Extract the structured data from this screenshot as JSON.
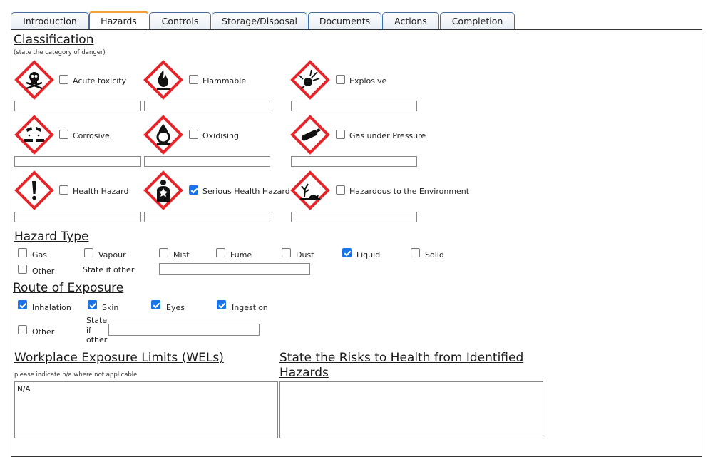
{
  "tabs": [
    "Introduction",
    "Hazards",
    "Controls",
    "Storage/Disposal",
    "Documents",
    "Actions",
    "Completion"
  ],
  "active_tab": "Hazards",
  "classification": {
    "title": "Classification",
    "note": "(state the category of danger)",
    "items": [
      {
        "label": "Acute toxicity",
        "checked": false,
        "icon": "skull-crossbones-icon"
      },
      {
        "label": "Flammable",
        "checked": false,
        "icon": "flame-icon"
      },
      {
        "label": "Explosive",
        "checked": false,
        "icon": "exploding-bomb-icon"
      },
      {
        "label": "Corrosive",
        "checked": false,
        "icon": "corrosion-icon"
      },
      {
        "label": "Oxidising",
        "checked": false,
        "icon": "flame-over-circle-icon"
      },
      {
        "label": "Gas under Pressure",
        "checked": false,
        "icon": "gas-cylinder-icon"
      },
      {
        "label": "Health Hazard",
        "checked": false,
        "icon": "exclamation-mark-icon"
      },
      {
        "label": "Serious Health Hazard",
        "checked": true,
        "icon": "health-hazard-icon"
      },
      {
        "label": "Hazardous to the Environment",
        "checked": false,
        "icon": "environment-icon"
      }
    ]
  },
  "hazard_type": {
    "title": "Hazard Type",
    "options": [
      {
        "label": "Gas",
        "checked": false
      },
      {
        "label": "Vapour",
        "checked": false
      },
      {
        "label": "Mist",
        "checked": false
      },
      {
        "label": "Fume",
        "checked": false
      },
      {
        "label": "Dust",
        "checked": false
      },
      {
        "label": "Liquid",
        "checked": true
      },
      {
        "label": "Solid",
        "checked": false
      },
      {
        "label": "Other",
        "checked": false
      }
    ],
    "state_if_other_label": "State if other",
    "state_if_other_value": ""
  },
  "route_of_exposure": {
    "title": "Route of Exposure",
    "options": [
      {
        "label": "Inhalation",
        "checked": true
      },
      {
        "label": "Skin",
        "checked": true
      },
      {
        "label": "Eyes",
        "checked": true
      },
      {
        "label": "Ingestion",
        "checked": true
      },
      {
        "label": "Other",
        "checked": false
      }
    ],
    "state_if_other_label": "State\nif\nother",
    "state_if_other_value": ""
  },
  "wels": {
    "title": "Workplace Exposure Limits (WELs)",
    "note": "please indicate n/a where not applicable",
    "value": "N/A"
  },
  "risks": {
    "title_line1": "State the Risks to Health from Identified",
    "title_line2": "Hazards",
    "value": ""
  },
  "colors": {
    "pictogram_border": "#e5252a",
    "tab_active_accent": "#f2a23a",
    "checkbox_checked": "#1a73e8",
    "tab_border": "#4a6d9c"
  }
}
